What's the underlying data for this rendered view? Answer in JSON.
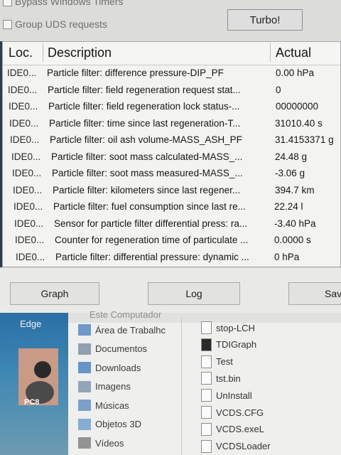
{
  "options": {
    "bypass_timers_label": "Bypass Windows Timers",
    "group_uds_label": "Group UDS requests",
    "turbo_label": "Turbo!"
  },
  "table": {
    "headers": {
      "loc": "Loc.",
      "description": "Description",
      "actual": "Actual"
    },
    "rows": [
      {
        "loc": "IDE0...",
        "description": "Particle filter: difference pressure-DIP_PF",
        "actual": "0.00 hPa"
      },
      {
        "loc": "IDE0...",
        "description": "Particle filter: field regeneration request stat...",
        "actual": "0"
      },
      {
        "loc": "IDE0...",
        "description": "Particle filter: field regeneration lock status-...",
        "actual": "00000000"
      },
      {
        "loc": "IDE0...",
        "description": "Particle filter: time since last regeneration-T...",
        "actual": "31010.40 s"
      },
      {
        "loc": "IDE0...",
        "description": "Particle filter: oil ash volume-MASS_ASH_PF",
        "actual": "31.4153371 g"
      },
      {
        "loc": "IDE0...",
        "description": "Particle filter: soot mass calculated-MASS_...",
        "actual": "24.48 g"
      },
      {
        "loc": "IDE0...",
        "description": "Particle filter: soot mass measured-MASS_...",
        "actual": "-3.06 g"
      },
      {
        "loc": "IDE0...",
        "description": "Particle filter: kilometers since last regener...",
        "actual": "394.7 km"
      },
      {
        "loc": "IDE0...",
        "description": "Particle filter: fuel consumption since last re...",
        "actual": "22.24 l"
      },
      {
        "loc": "IDE0...",
        "description": "Sensor for particle filter differential press: ra...",
        "actual": "-3.40 hPa"
      },
      {
        "loc": "IDE0...",
        "description": "Counter for regeneration time of particulate ...",
        "actual": "0.0000 s"
      },
      {
        "loc": "IDE0...",
        "description": "Particle filter: differential pressure: dynamic ...",
        "actual": "0 hPa"
      }
    ]
  },
  "buttons": {
    "graph": "Graph",
    "log": "Log",
    "save": "Sav"
  },
  "desktop": {
    "edge_label": "Edge",
    "pc_label": "PC8"
  },
  "explorer": {
    "header": "Este Computador",
    "nav": [
      {
        "label": "Área de Trabalhc",
        "icon": "desktop-icon"
      },
      {
        "label": "Documentos",
        "icon": "documents-icon"
      },
      {
        "label": "Downloads",
        "icon": "downloads-icon"
      },
      {
        "label": "Imagens",
        "icon": "pictures-icon"
      },
      {
        "label": "Músicas",
        "icon": "music-icon"
      },
      {
        "label": "Objetos 3D",
        "icon": "3d-objects-icon"
      },
      {
        "label": "Vídeos",
        "icon": "videos-icon"
      }
    ],
    "files": [
      {
        "label": "stop-LCH",
        "icon": "file-icon"
      },
      {
        "label": "TDIGraph",
        "icon": "app-icon"
      },
      {
        "label": "Test",
        "icon": "file-icon"
      },
      {
        "label": "tst.bin",
        "icon": "file-icon"
      },
      {
        "label": "UnInstall",
        "icon": "uninstall-icon"
      },
      {
        "label": "VCDS.CFG",
        "icon": "file-icon"
      },
      {
        "label": "VCDS.exeL",
        "icon": "file-icon"
      },
      {
        "label": "VCDSLoader",
        "icon": "file-icon"
      }
    ]
  }
}
